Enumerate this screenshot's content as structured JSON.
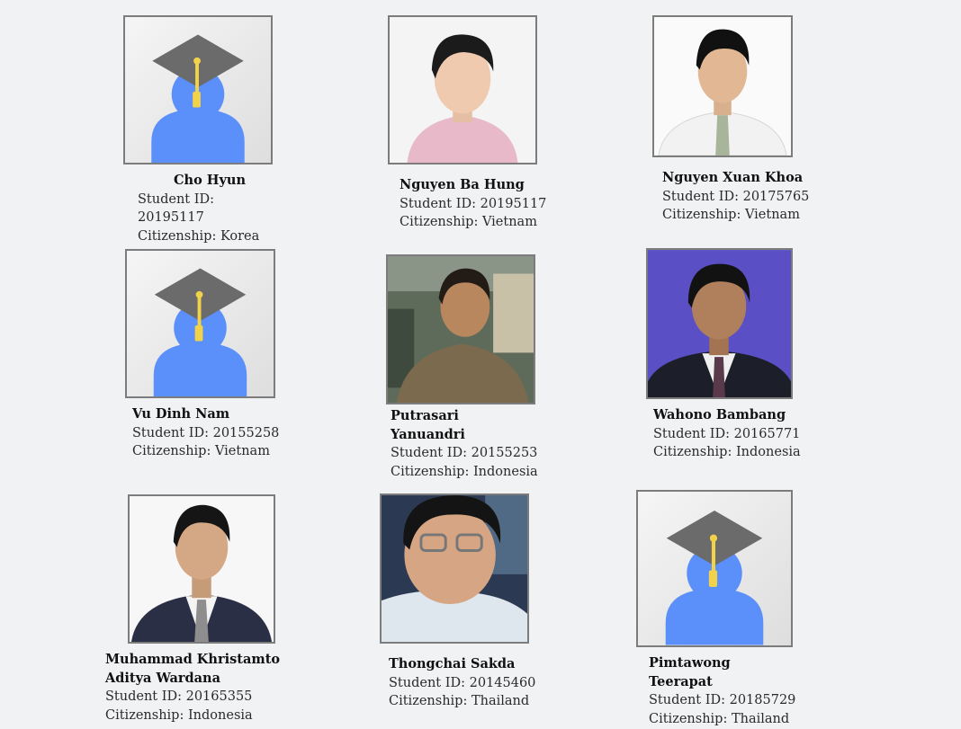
{
  "labels": {
    "student_id": "Student ID:",
    "citizenship": "Citizenship:"
  },
  "students": [
    {
      "name": "Cho Hyun",
      "student_id": "20195117",
      "citizenship": "Korea",
      "photo": "placeholder-graduate-avatar"
    },
    {
      "name": "Nguyen Ba Hung",
      "student_id": "20195117",
      "citizenship": "Vietnam",
      "photo": "portrait-photo"
    },
    {
      "name": "Nguyen Xuan Khoa",
      "student_id": "20175765",
      "citizenship": "Vietnam",
      "photo": "portrait-photo"
    },
    {
      "name": "Vu Dinh Nam",
      "student_id": "20155258",
      "citizenship": "Vietnam",
      "photo": "placeholder-graduate-avatar"
    },
    {
      "name": "Putrasari Yanuandri",
      "student_id": "20155253",
      "citizenship": "Indonesia",
      "photo": "portrait-photo"
    },
    {
      "name": "Wahono Bambang",
      "student_id": "20165771",
      "citizenship": "Indonesia",
      "photo": "portrait-photo"
    },
    {
      "name": "Muhammad Khristamto Aditya Wardana",
      "student_id": "20165355",
      "citizenship": "Indonesia",
      "photo": "portrait-photo"
    },
    {
      "name": "Thongchai Sakda",
      "student_id": "20145460",
      "citizenship": "Thailand",
      "photo": "portrait-photo"
    },
    {
      "name": "Pimtawong Teerapat",
      "student_id": "20185729",
      "citizenship": "Thailand",
      "photo": "placeholder-graduate-avatar"
    }
  ],
  "colors": {
    "avatar_body": "#5b8ff9",
    "cap": "#6b6b6b",
    "tassel": "#f2d24a",
    "frame_border": "#7c7c7c"
  }
}
